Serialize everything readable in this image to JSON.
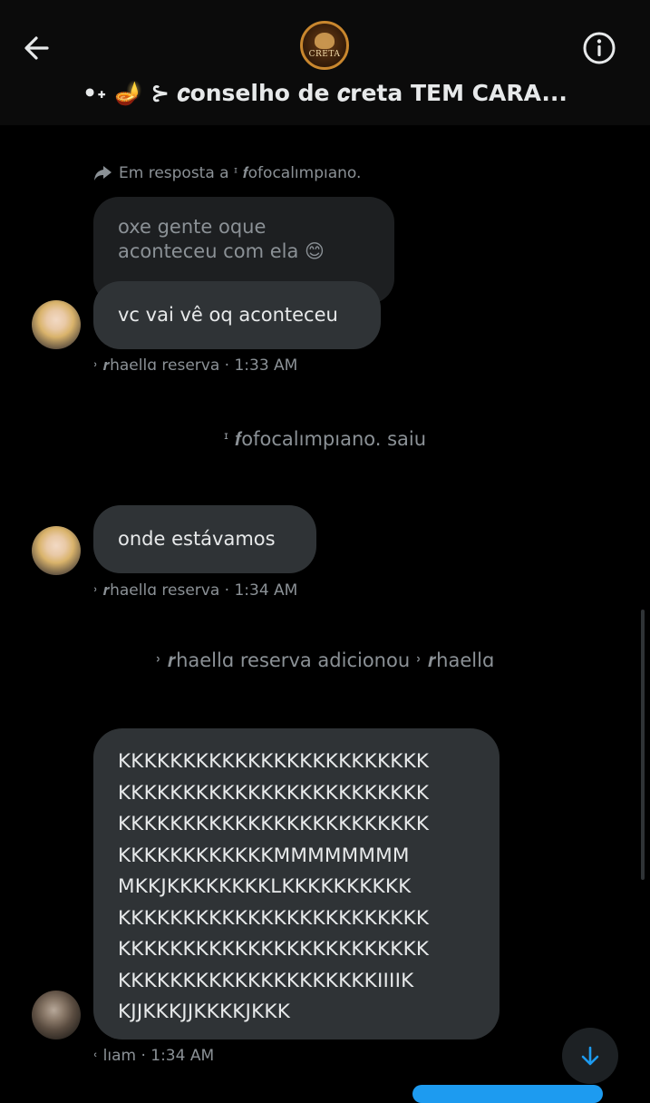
{
  "header": {
    "title": "•˖ 🪔 ⊱ 𝒄onselho de 𝒄reta TEM CARA...",
    "avatar_text": "CRETA",
    "back_icon": "arrow-left-icon",
    "info_icon": "info-circle-icon"
  },
  "reply": {
    "label": "Em resposta a ᶦ 𝒇ofocalımpıano.",
    "quoted_text": "oxe gente oque aconteceu com ela 😊"
  },
  "messages": [
    {
      "text": "vc vai vê oq aconteceu",
      "meta": "˒ 𝒓haellɑ reserva · 1:33 AM"
    },
    {
      "text": "onde estávamos",
      "meta": "˒ 𝒓haellɑ reserva · 1:34 AM"
    },
    {
      "text_lines": [
        "KKKKKKKKKKKKKKKKKKKKKKKK",
        "KKKKKKKKKKKKKKKKKKKKKKKK",
        "KKKKKKKKKKKKKKKKKKKKKKKK",
        "KKKKKKKKKKKKMMMMMMMM",
        "MKKJKKKKKKKKLKKKKKKKKKK",
        "KKKKKKKKKKKKKKKKKKKKKKKK",
        "KKKKKKKKKKKKKKKKKKKKKKKK",
        "KKKKKKKKKKKKKKKKKKKKIIIIK",
        "KJJKKKJJKKKKJKKK"
      ],
      "meta": "˓ lıam · 1:34 AM"
    }
  ],
  "system": {
    "left_notice": "ᶦ 𝒇ofocalımpıano. saiu",
    "added_notice": "˒ 𝒓haellɑ reserva adicionou ˒ 𝒓haellɑ"
  },
  "controls": {
    "scroll_down_icon": "arrow-down-icon"
  }
}
